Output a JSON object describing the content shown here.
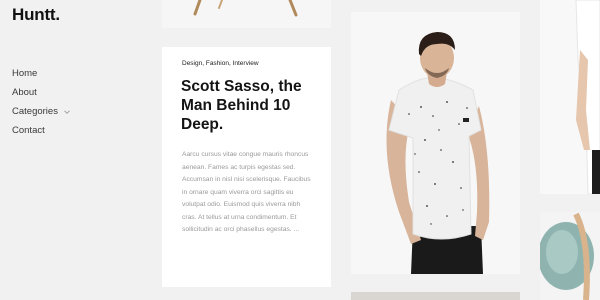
{
  "brand": {
    "logo": "Huntt."
  },
  "nav": {
    "items": [
      {
        "label": "Home"
      },
      {
        "label": "About"
      },
      {
        "label": "Categories",
        "has_dropdown": true
      },
      {
        "label": "Contact"
      }
    ]
  },
  "article": {
    "tags": "Design, Fashion, Interview",
    "title": "Scott Sasso, the Man Behind 10 Deep.",
    "excerpt": "Aarcu cursus vitae congue mauris rhoncus aenean. Fames ac turpis egestas sed. Accumsan in nisl nisi scelerisque. Faucibus in ornare quam viverra orci sagittis eu volutpat odio. Euismod quis viverra nibh cras. At tellus at urna condimentum. Et sollicitudin ac orci phasellus egestas. ..."
  },
  "colors": {
    "background": "#f1f1f1",
    "card": "#ffffff",
    "text": "#1b1b1b",
    "muted_text": "#9a9a9a"
  },
  "icons": {
    "dropdown": "chevron-down-icon"
  }
}
